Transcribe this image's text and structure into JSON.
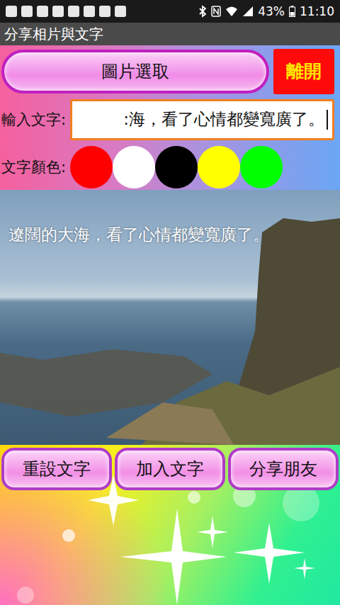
{
  "status_bar": {
    "battery": "43%",
    "time": "11:10"
  },
  "title": "分享相片與文字",
  "pick_button": "圖片選取",
  "exit_button": "離開",
  "text_input": {
    "label": "輸入文字:",
    "value": ":海，看了心情都變寬廣了。"
  },
  "colors": {
    "label": "文字顏色:",
    "swatches": [
      {
        "color": "#ff0000"
      },
      {
        "color": "#ffffff"
      },
      {
        "color": "#000000"
      },
      {
        "color": "#ffff00"
      },
      {
        "color": "#00ff00"
      }
    ]
  },
  "photo": {
    "caption": "遼闊的大海，看了心情都變寬廣了。"
  },
  "buttons": [
    "重設文字",
    "加入文字",
    "分享朋友"
  ]
}
